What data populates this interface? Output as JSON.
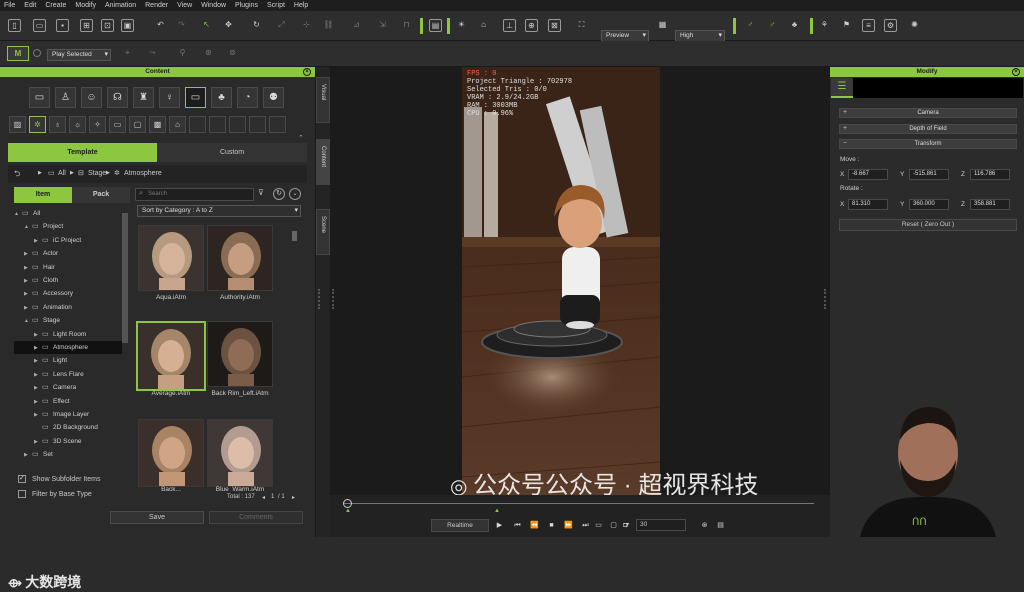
{
  "menu": [
    "File",
    "Edit",
    "Create",
    "Modify",
    "Animation",
    "Render",
    "View",
    "Window",
    "Plugins",
    "Script",
    "Help"
  ],
  "toolbar": {
    "preview_select": "Preview",
    "quality_select": "High"
  },
  "toolbar2": {
    "play_select": "Play Selected"
  },
  "content": {
    "title": "Content",
    "tabs": {
      "template": "Template",
      "custom": "Custom"
    },
    "breadcrumb": [
      "All",
      "Stage",
      "Atmosphere"
    ],
    "subtabs": {
      "item": "Item",
      "pack": "Pack"
    },
    "search_placeholder": "Search",
    "sort": "Sort by Category : A to Z",
    "tree": [
      {
        "label": "All",
        "indent": 0,
        "expand": "▲"
      },
      {
        "label": "Project",
        "indent": 1,
        "expand": "▲"
      },
      {
        "label": "iC Project",
        "indent": 2,
        "expand": "▶"
      },
      {
        "label": "Actor",
        "indent": 1,
        "expand": "▶"
      },
      {
        "label": "Hair",
        "indent": 1,
        "expand": "▶"
      },
      {
        "label": "Cloth",
        "indent": 1,
        "expand": "▶"
      },
      {
        "label": "Accessory",
        "indent": 1,
        "expand": "▶"
      },
      {
        "label": "Animation",
        "indent": 1,
        "expand": "▶"
      },
      {
        "label": "Stage",
        "indent": 1,
        "expand": "▲"
      },
      {
        "label": "Light Room",
        "indent": 2,
        "expand": "▶"
      },
      {
        "label": "Atmosphere",
        "indent": 2,
        "expand": "▶",
        "selected": true
      },
      {
        "label": "Light",
        "indent": 2,
        "expand": "▶"
      },
      {
        "label": "Lens Flare",
        "indent": 2,
        "expand": "▶"
      },
      {
        "label": "Camera",
        "indent": 2,
        "expand": "▶"
      },
      {
        "label": "Effect",
        "indent": 2,
        "expand": "▶"
      },
      {
        "label": "Image Layer",
        "indent": 2,
        "expand": "▶"
      },
      {
        "label": "2D Background",
        "indent": 2,
        "expand": ""
      },
      {
        "label": "3D Scene",
        "indent": 2,
        "expand": "▶"
      },
      {
        "label": "Set",
        "indent": 1,
        "expand": "▶"
      }
    ],
    "items": [
      "Aqua.iAtm",
      "Authority.iAtm",
      "Average.iAtm",
      "Back Rim_Left.iAtm",
      "Back...",
      "Blue_Warm.iAtm"
    ],
    "show_subfolder": "Show Subfolder Items",
    "filter_base": "Filter by Base Type",
    "total": "Total : 137",
    "page": "1",
    "page_of": "/ 1",
    "save": "Save",
    "comments": "Comments"
  },
  "side_tabs": [
    "Visual",
    "Content",
    "Scene"
  ],
  "viewport": {
    "fps": "FPS : 0",
    "stats": [
      "Project Triangle : 702978",
      "Selected Tris : 0/0",
      "VRAM : 2.9/24.2GB",
      "RAM : 3003MB",
      "CPU : 0.96%"
    ]
  },
  "modify": {
    "title": "Modify",
    "sections": {
      "camera": "Camera",
      "dof": "Depth of Field",
      "transform": "Transform"
    },
    "move_label": "Move :",
    "rotate_label": "Rotate :",
    "axes": [
      "X",
      "Y",
      "Z"
    ],
    "move": [
      "-8.667",
      "-515.861",
      "116.786"
    ],
    "rotate": [
      "81.310",
      "360.000",
      "358.881"
    ],
    "reset": "Reset ( Zero Out )"
  },
  "timeline": {
    "realtime": "Realtime",
    "frame": "30"
  },
  "watermark": {
    "text": "公众号公众号 · 超视界科技",
    "logo": "大数跨境"
  }
}
